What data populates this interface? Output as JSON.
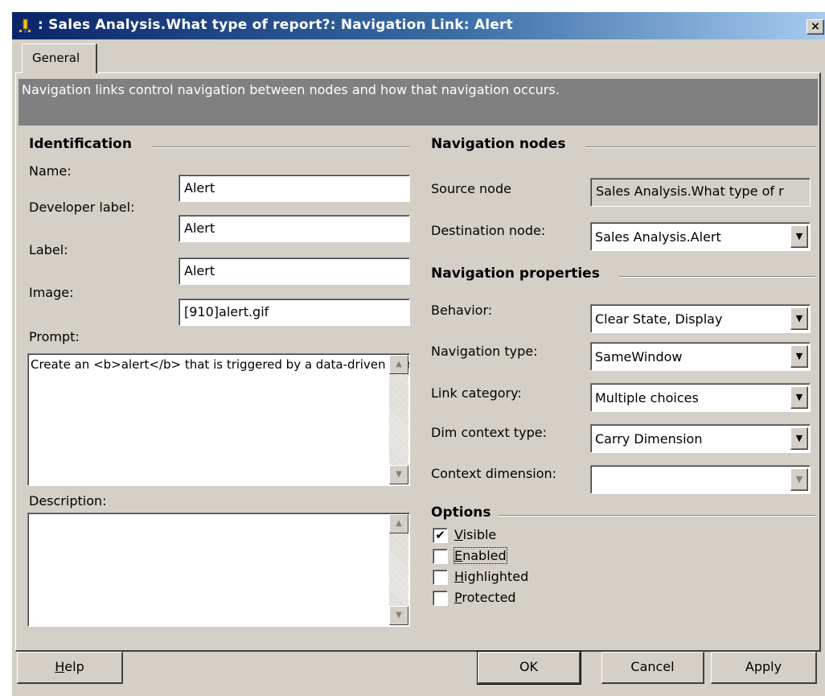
{
  "window": {
    "title": ": Sales Analysis.What type of report?: Navigation Link: Alert",
    "close_glyph": "×"
  },
  "tabs": [
    {
      "label": "General"
    }
  ],
  "banner": {
    "text": "Navigation links control navigation between nodes and how that navigation occurs."
  },
  "identification": {
    "header": "Identification",
    "name": {
      "label": "Name:",
      "value": "Alert"
    },
    "developer_label": {
      "label": "Developer label:",
      "value": "Alert"
    },
    "label": {
      "label": "Label:",
      "value": "Alert"
    },
    "image": {
      "label": "Image:",
      "value": "[910]alert.gif"
    },
    "prompt": {
      "label": "Prompt:",
      "value": "Create an <b>alert</b> that is triggered by a data-driven condition."
    },
    "description": {
      "label": "Description:",
      "value": ""
    }
  },
  "navigation_nodes": {
    "header": "Navigation nodes",
    "source_node": {
      "label": "Source node",
      "value": "Sales Analysis.What type of r"
    },
    "destination_node": {
      "label": "Destination node:",
      "value": "Sales Analysis.Alert"
    }
  },
  "navigation_properties": {
    "header": "Navigation properties",
    "behavior": {
      "label": "Behavior:",
      "value": "Clear State, Display"
    },
    "navigation_type": {
      "label": "Navigation type:",
      "value": "SameWindow"
    },
    "link_category": {
      "label": "Link category:",
      "value": "Multiple choices"
    },
    "dim_context_type": {
      "label": "Dim context type:",
      "value": "Carry Dimension"
    },
    "context_dimension": {
      "label": "Context dimension:",
      "value": ""
    }
  },
  "options": {
    "header": "Options",
    "visible": {
      "label": "Visible",
      "checked": true,
      "mark": "✔"
    },
    "enabled": {
      "label": "Enabled",
      "checked": false
    },
    "highlighted": {
      "label": "Highlighted",
      "checked": false
    },
    "protected": {
      "label": "Protected",
      "checked": false
    }
  },
  "buttons": {
    "help": "Help",
    "ok": "OK",
    "cancel": "Cancel",
    "apply": "Apply"
  },
  "icons": {
    "dropdown_arrow": "▼",
    "scroll_up": "▲",
    "scroll_down": "▼",
    "app_icon": "navigation-link-icon"
  }
}
